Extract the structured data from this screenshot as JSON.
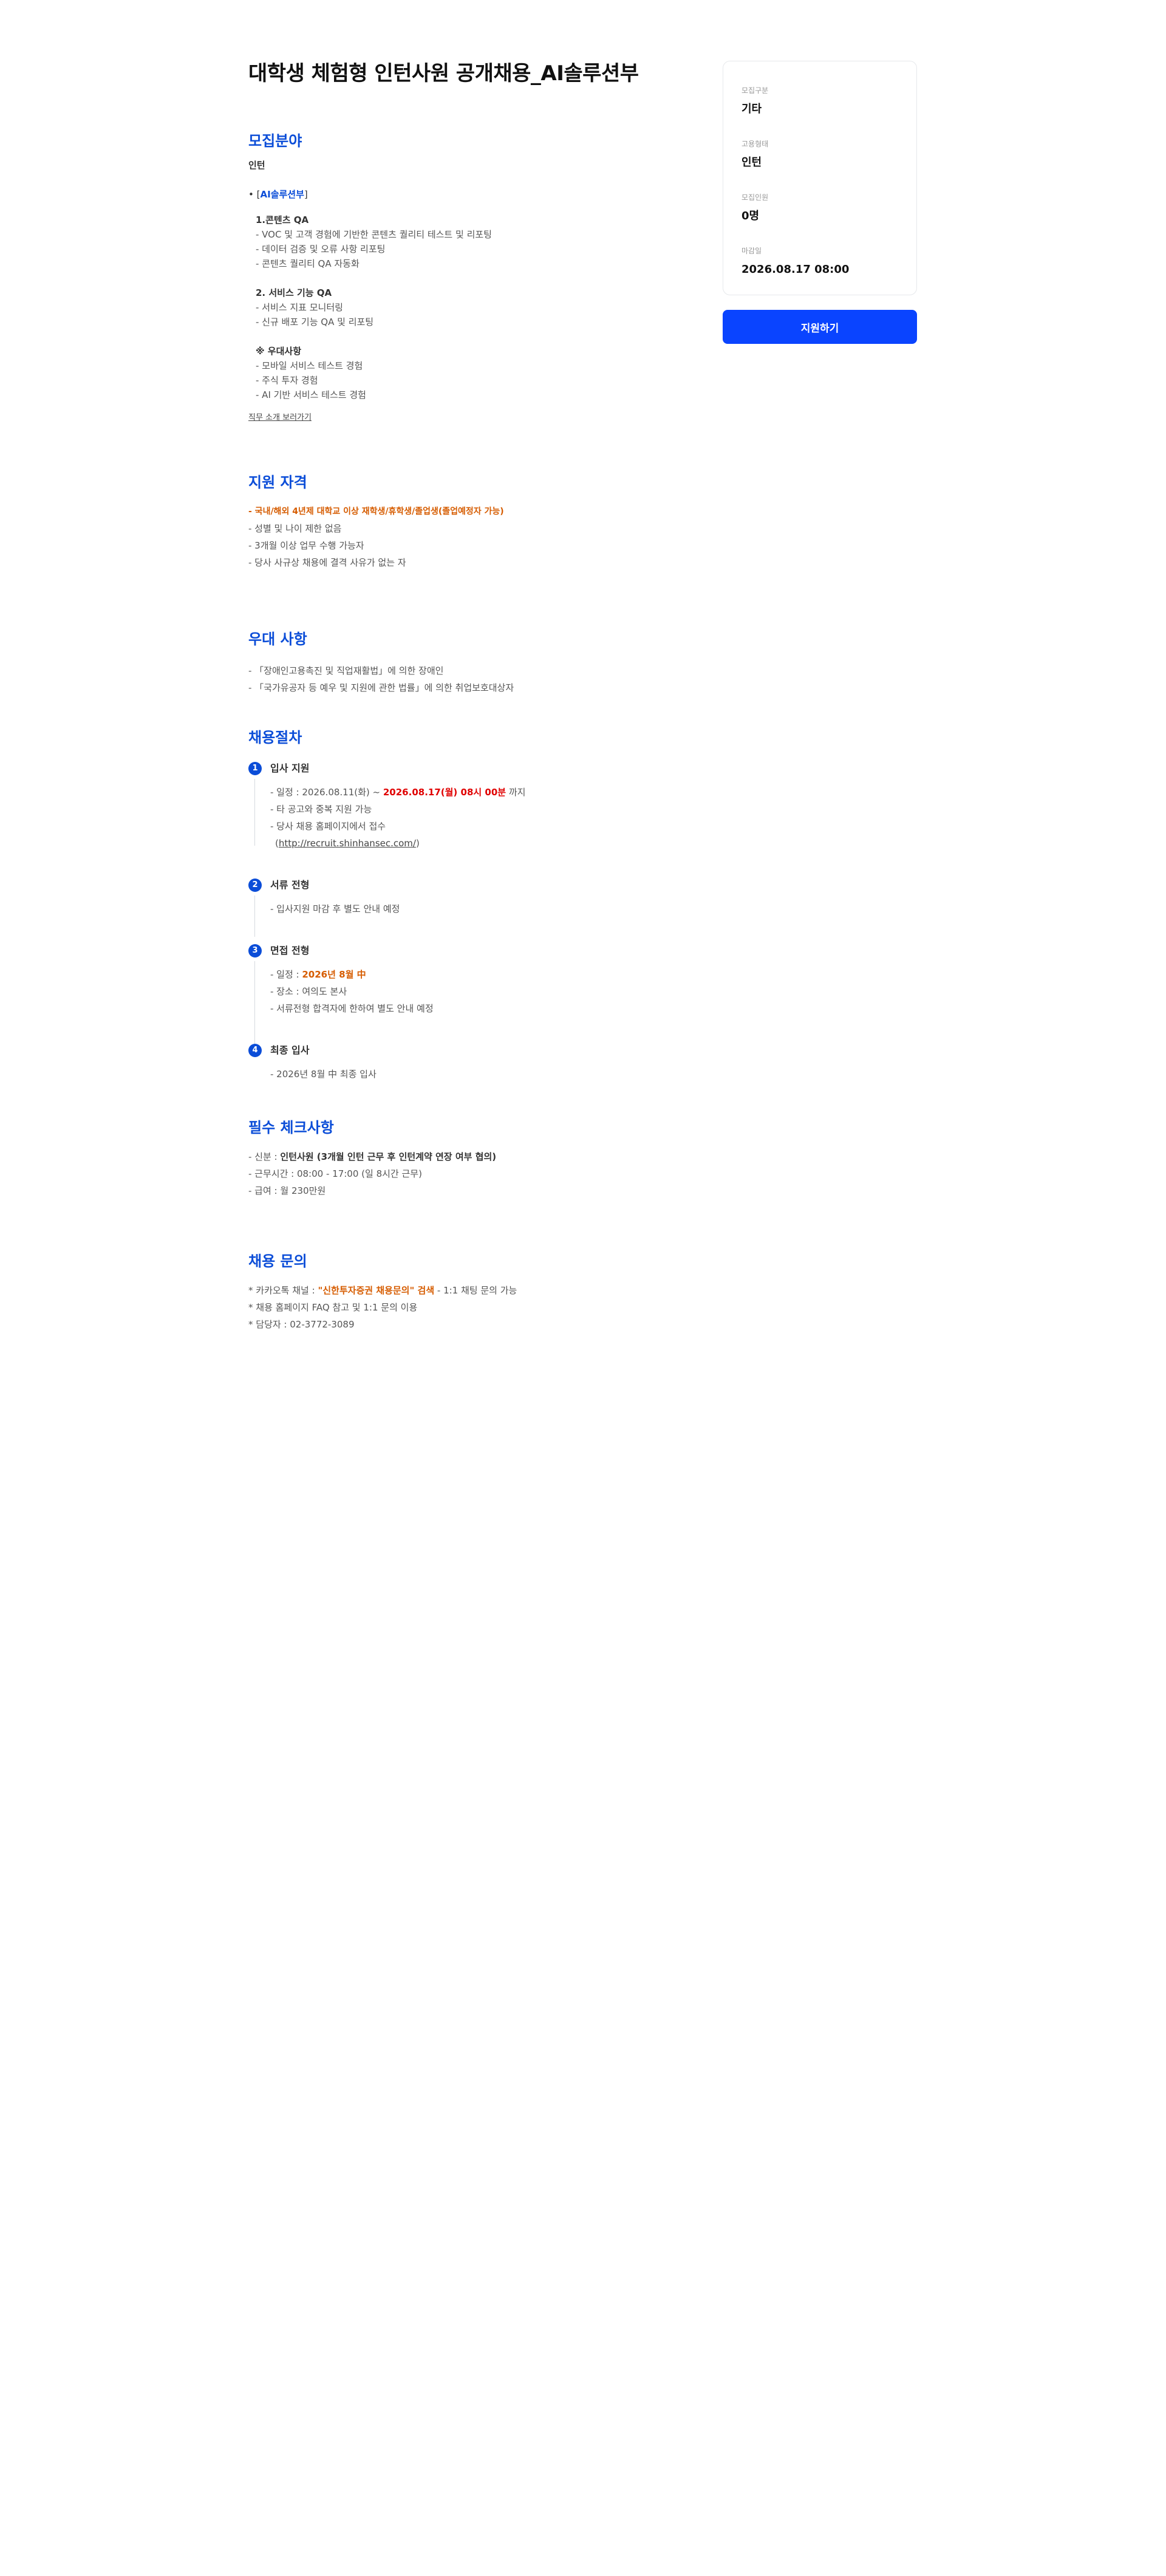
{
  "job": {
    "title": "대학생 체험형 인턴사원 공개채용_AI솔루션부"
  },
  "recruit_field": {
    "heading": "모집분야",
    "type": "인턴",
    "dept_bullet": "•",
    "dept_open": "[",
    "dept_name": "AI솔루션부",
    "dept_close": "]",
    "group1_title": "1.콘텐츠 QA",
    "group1_items": [
      "- VOC 및 고객 경험에 기반한 콘텐츠 퀄리티 테스트 및 리포팅",
      "- 데이터 검증 및 오류 사항 리포팅",
      "- 콘텐츠 퀄리티 QA 자동화"
    ],
    "group2_title": "2. 서비스 기능 QA",
    "group2_items": [
      "- 서비스 지표 모니터링",
      "- 신규 배포 기능 QA 및 리포팅"
    ],
    "group3_title": "※ 우대사항",
    "group3_items": [
      "- 모바일 서비스 테스트 경험",
      "- 주식 투자 경험",
      "- AI 기반 서비스 테스트 경험"
    ],
    "more_link": "직무 소개 보러가기"
  },
  "qualification": {
    "heading": "지원 자격",
    "highlight": "- 국내/해외 4년제 대학교 이상 재학생/휴학생/졸업생(졸업예정자 가능)",
    "items": [
      "- 성별 및 나이 제한 없음",
      "- 3개월 이상 업무 수행 가능자",
      "- 당사 사규상 채용에 결격 사유가 없는 자"
    ]
  },
  "preference": {
    "heading": "우대 사항",
    "items": [
      "- 「장애인고용촉진 및 직업재활법」에 의한 장애인",
      "- 「국가유공자 등 예우 및 지원에 관한 법률」에 의한 취업보호대상자"
    ]
  },
  "process": {
    "heading": "채용절차",
    "steps": [
      {
        "num": "1",
        "title": "입사 지원",
        "schedule_prefix": "- 일정 : 2026.08.11(화) ~ ",
        "schedule_highlight": "2026.08.17(월) 08시 00분",
        "schedule_suffix": " 까지",
        "line2": "- 타 공고와 중복 지원 가능",
        "line3": "- 당사 채용 홈페이지에서 접수",
        "link_open": "(",
        "link": "http://recruit.shinhansec.com/",
        "link_close": ")"
      },
      {
        "num": "2",
        "title": "서류 전형",
        "line1": "- 입사지원 마감 후 별도 안내 예정"
      },
      {
        "num": "3",
        "title": "면접 전형",
        "schedule_prefix": "- 일정 : ",
        "schedule_highlight": "2026년 8월 中",
        "line2": "- 장소 : 여의도 본사",
        "line3": "- 서류전형 합격자에 한하여 별도 안내 예정"
      },
      {
        "num": "4",
        "title": "최종 입사",
        "line1": "- 2026년 8월 中 최종 입사"
      }
    ]
  },
  "checklist": {
    "heading": "필수 체크사항",
    "status_prefix": "- 신분 : ",
    "status_value": "인턴사원 (3개월 인턴 근무 후 인턴계약 연장 여부 협의)",
    "hours": "- 근무시간 : 08:00 - 17:00 (일 8시간 근무)",
    "pay": "- 급여 : 월 230만원"
  },
  "inquiry": {
    "heading": "채용 문의",
    "kakao_prefix": "* 카카오톡 채널 : ",
    "kakao_highlight": "\"신한투자증권 채용문의\" 검색",
    "kakao_suffix": " - 1:1 채팅 문의 가능",
    "faq": "* 채용 홈페이지 FAQ 참고 및 1:1 문의 이용",
    "contact": "* 담당자 : 02-3772-3089"
  },
  "summary": {
    "category_label": "모집구분",
    "category_value": "기타",
    "employment_label": "고용형태",
    "employment_value": "인턴",
    "headcount_label": "모집인원",
    "headcount_value": "0명",
    "deadline_label": "마감일",
    "deadline_value": "2026.08.17 08:00"
  },
  "apply_button": "지원하기",
  "colors": {
    "accent": "#0b4dd8",
    "button": "#0a44ff",
    "highlight_orange": "#d65c00",
    "highlight_red": "#e00000"
  }
}
